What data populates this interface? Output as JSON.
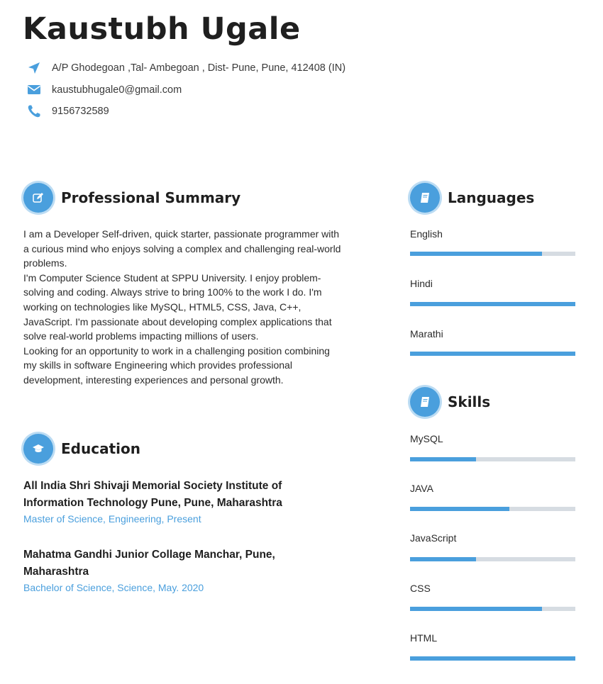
{
  "header": {
    "name": "Kaustubh Ugale",
    "address": "A/P Ghodegoan ,Tal- Ambegoan , Dist- Pune, Pune, 412408 (IN)",
    "email": "kaustubhugale0@gmail.com",
    "phone": "9156732589"
  },
  "summary": {
    "title": "Professional Summary",
    "paragraphs": [
      "I am a Developer  Self-driven, quick starter, passionate programmer with a curious mind who enjoys solving a complex and challenging real-world problems.",
      "I'm Computer Science Student at SPPU University.  I enjoy problem-solving and coding. Always strive to bring 100% to the work  I do. I'm working on technologies like MySQL, HTML5, CSS, Java, C++, JavaScript. I'm passionate about developing complex applications that solve real-world problems impacting millions of users.",
      "Looking for an opportunity to work in a challenging position combining my skills in software Engineering which provides professional development, interesting experiences and personal growth."
    ]
  },
  "education": {
    "title": "Education",
    "entries": [
      {
        "school": "All India Shri Shivaji Memorial Society Institute of Information Technology Pune, Pune, Maharashtra",
        "degree": "Master of Science, Engineering, Present"
      },
      {
        "school": "Mahatma Gandhi Junior Collage Manchar, Pune, Maharashtra",
        "degree": "Bachelor of Science, Science, May. 2020"
      }
    ]
  },
  "languages": {
    "title": "Languages",
    "items": [
      {
        "name": "English",
        "level": 0.8
      },
      {
        "name": "Hindi",
        "level": 1.0
      },
      {
        "name": "Marathi",
        "level": 1.0
      }
    ]
  },
  "skills": {
    "title": "Skills",
    "items": [
      {
        "name": "MySQL",
        "level": 0.4
      },
      {
        "name": "JAVA",
        "level": 0.6
      },
      {
        "name": "JavaScript",
        "level": 0.4
      },
      {
        "name": "CSS",
        "level": 0.8
      },
      {
        "name": "HTML",
        "level": 1.0
      }
    ]
  },
  "colors": {
    "accent": "#4a9fdd",
    "track": "#d6dce2",
    "text": "#2b2b2b"
  },
  "icons": [
    "location-arrow-icon",
    "envelope-icon",
    "phone-icon",
    "edit-icon",
    "graduation-cap-icon",
    "book-icon"
  ]
}
